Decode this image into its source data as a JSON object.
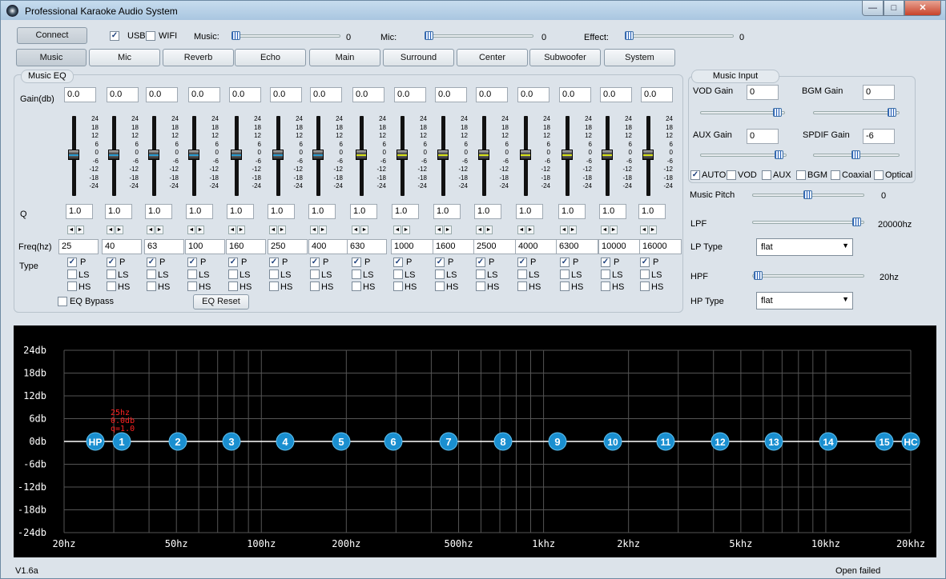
{
  "window": {
    "title": "Professional Karaoke Audio System",
    "minimize": "—",
    "maximize": "□",
    "close": "✕"
  },
  "top": {
    "connect_label": "Connect",
    "usb_label": "USB",
    "usb_checked": true,
    "wifi_label": "WIFI",
    "wifi_checked": false,
    "music_label": "Music:",
    "music_value": "0",
    "mic_label": "Mic:",
    "mic_value": "0",
    "effect_label": "Effect:",
    "effect_value": "0"
  },
  "tabs": [
    "Music",
    "Mic",
    "Reverb",
    "Echo",
    "Main",
    "Surround",
    "Center",
    "Subwoofer",
    "System"
  ],
  "active_tab": "Music",
  "eq": {
    "group_label": "Music EQ",
    "gain_label": "Gain(db)",
    "q_label": "Q",
    "freq_label": "Freq(hz)",
    "type_label": "Type",
    "scale": [
      "24",
      "18",
      "12",
      "6",
      "0",
      "-6",
      "-12",
      "-18",
      "-24"
    ],
    "bands": [
      {
        "gain": "0.0",
        "q": "1.0",
        "freq": "25"
      },
      {
        "gain": "0.0",
        "q": "1.0",
        "freq": "40"
      },
      {
        "gain": "0.0",
        "q": "1.0",
        "freq": "63"
      },
      {
        "gain": "0.0",
        "q": "1.0",
        "freq": "100"
      },
      {
        "gain": "0.0",
        "q": "1.0",
        "freq": "160"
      },
      {
        "gain": "0.0",
        "q": "1.0",
        "freq": "250"
      },
      {
        "gain": "0.0",
        "q": "1.0",
        "freq": "400"
      },
      {
        "gain": "0.0",
        "q": "1.0",
        "freq": "630"
      },
      {
        "gain": "0.0",
        "q": "1.0",
        "freq": "1000"
      },
      {
        "gain": "0.0",
        "q": "1.0",
        "freq": "1600"
      },
      {
        "gain": "0.0",
        "q": "1.0",
        "freq": "2500"
      },
      {
        "gain": "0.0",
        "q": "1.0",
        "freq": "4000"
      },
      {
        "gain": "0.0",
        "q": "1.0",
        "freq": "6300"
      },
      {
        "gain": "0.0",
        "q": "1.0",
        "freq": "10000"
      },
      {
        "gain": "0.0",
        "q": "1.0",
        "freq": "16000"
      }
    ],
    "type_p": "P",
    "type_ls": "LS",
    "type_hs": "HS",
    "bypass_label": "EQ Bypass",
    "reset_label": "EQ Reset"
  },
  "music_input": {
    "group_label": "Music Input",
    "vod_gain_label": "VOD Gain",
    "vod_gain": "0",
    "bgm_gain_label": "BGM Gain",
    "bgm_gain": "0",
    "aux_gain_label": "AUX Gain",
    "aux_gain": "0",
    "spdif_gain_label": "SPDIF Gain",
    "spdif_gain": "-6",
    "sources": [
      {
        "label": "AUTO",
        "checked": true
      },
      {
        "label": "VOD",
        "checked": false
      },
      {
        "label": "AUX",
        "checked": false
      },
      {
        "label": "BGM",
        "checked": false
      },
      {
        "label": "Coaxial",
        "checked": false
      },
      {
        "label": "Optical",
        "checked": false
      }
    ]
  },
  "right": {
    "pitch_label": "Music Pitch",
    "pitch_value": "0",
    "lpf_label": "LPF",
    "lpf_value": "20000hz",
    "lp_type_label": "LP Type",
    "lp_type": "flat",
    "hpf_label": "HPF",
    "hpf_value": "20hz",
    "hp_type_label": "HP Type",
    "hp_type": "flat"
  },
  "graph": {
    "y_labels": [
      "24db",
      "18db",
      "12db",
      "6db",
      "0db",
      "-6db",
      "-12db",
      "-18db",
      "-24db"
    ],
    "x_labels": [
      "20hz",
      "50hz",
      "100hz",
      "200hz",
      "500hz",
      "1khz",
      "2khz",
      "5khz",
      "10khz",
      "20khz"
    ],
    "nodes": [
      "HP",
      "1",
      "2",
      "3",
      "4",
      "5",
      "6",
      "7",
      "8",
      "9",
      "10",
      "11",
      "12",
      "13",
      "14",
      "15",
      "HC"
    ],
    "tooltip": [
      "25hz",
      "0.0db",
      "q=1.0"
    ],
    "line_color": "#ffffff",
    "node_color": "#1a8fd0",
    "tooltip_color": "#ff2222"
  },
  "status": {
    "version": "V1.6a",
    "message": "Open failed"
  }
}
